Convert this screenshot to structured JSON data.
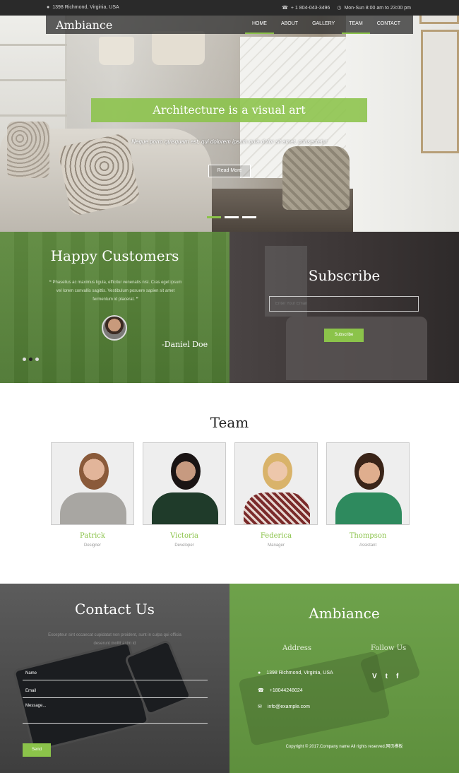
{
  "topbar": {
    "address": "1398 Richmond, Virginia, USA",
    "phone": "+ 1 804-043-3496",
    "hours": "Mon-Sun 8:00 am to 23:00 pm"
  },
  "nav": {
    "brand": "Ambiance",
    "items": [
      "HOME",
      "ABOUT",
      "GALLERY",
      "TEAM",
      "CONTACT"
    ],
    "active": [
      "HOME",
      "TEAM"
    ]
  },
  "hero": {
    "title": "Architecture is a visual art",
    "tagline": "Neque porro quisquam est, qui dolorem ipsum quia dolor sit amet, consectetur",
    "button": "Read More",
    "slides": 3,
    "active_slide": 1
  },
  "testimonial": {
    "heading": "Happy Customers",
    "quote": "❝ Phasellus ac maximus ligula, efficitur venenatis nisl. Cras eget ipsum vel lorem convallis sagittis. Vestibulum posuere sapien sit amet fermentum id placerat. ❞",
    "author": "-Daniel Doe",
    "dots": 3,
    "active_dot": 2
  },
  "subscribe": {
    "heading": "Subscribe",
    "placeholder": "Enter Your Email",
    "button": "Subscribe"
  },
  "team": {
    "heading": "Team",
    "members": [
      {
        "name": "Patrick",
        "role": "Designer"
      },
      {
        "name": "Victoria",
        "role": "Developer"
      },
      {
        "name": "Federica",
        "role": "Manager"
      },
      {
        "name": "Thompson",
        "role": "Assistant"
      }
    ]
  },
  "contact": {
    "heading": "Contact Us",
    "description": "Excepteur sint occaecat cupidatat non proident, sunt in culpa qui officia deserunt mollit anim id",
    "fields": {
      "name": "Name",
      "email": "Email",
      "message": "Message..."
    },
    "button": "Send"
  },
  "footer": {
    "brand": "Ambiance",
    "address_heading": "Address",
    "follow_heading": "Follow Us",
    "address": "1398 Richmond, Virginia, USA",
    "phone": "+18044248024",
    "email": "info@example.com",
    "social": [
      "V",
      "t",
      "f"
    ],
    "copyright": "Copyright © 2017.Company name All rights reserved.网页模板"
  },
  "colors": {
    "accent": "#8bc34a",
    "topbar": "#2a2a2a"
  }
}
